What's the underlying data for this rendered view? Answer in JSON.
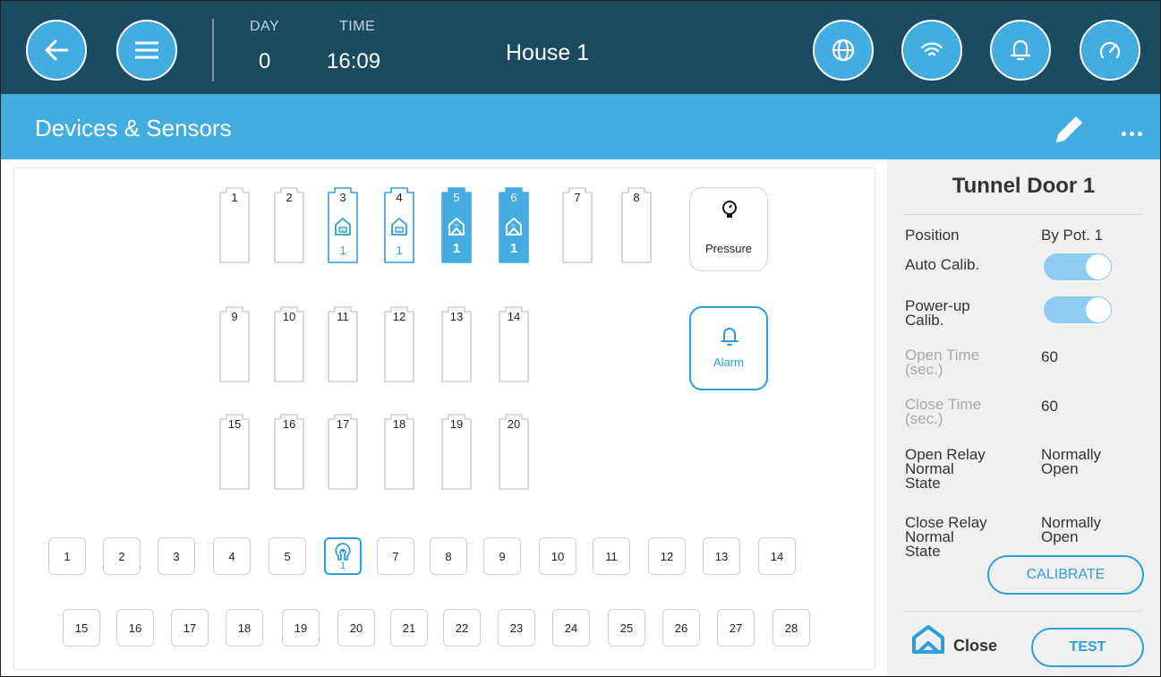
{
  "header": {
    "day_label": "DAY",
    "day_value": "0",
    "time_label": "TIME",
    "time_value": "16:09",
    "house_title": "House 1",
    "icons": [
      "back-arrow-icon",
      "menu-icon",
      "globe-icon",
      "wifi-icon",
      "bell-icon",
      "gauge-icon"
    ]
  },
  "titlebar": {
    "title": "Devices & Sensors",
    "icons": [
      "pencil-icon",
      "more-icon"
    ]
  },
  "relays": [
    {
      "label": "1"
    },
    {
      "label": "2"
    },
    {
      "label": "3",
      "state": "assigned",
      "sub": "1",
      "icon": "door-open-icon"
    },
    {
      "label": "4",
      "state": "assigned",
      "sub": "1",
      "icon": "door-close-icon"
    },
    {
      "label": "5",
      "state": "active",
      "sub": "1",
      "icon": "tunnel-open-icon"
    },
    {
      "label": "6",
      "state": "active",
      "sub": "1",
      "icon": "tunnel-close-icon"
    },
    {
      "label": "7"
    },
    {
      "label": "8"
    },
    {
      "label": "9"
    },
    {
      "label": "10"
    },
    {
      "label": "11"
    },
    {
      "label": "12"
    },
    {
      "label": "13"
    },
    {
      "label": "14"
    },
    {
      "label": "15"
    },
    {
      "label": "16"
    },
    {
      "label": "17"
    },
    {
      "label": "18"
    },
    {
      "label": "19"
    },
    {
      "label": "20"
    }
  ],
  "cards": {
    "pressure_label": "Pressure",
    "alarm_label": "Alarm"
  },
  "inputs_row1": [
    "1",
    "2",
    "3",
    "4",
    "5",
    "6",
    "7",
    "8",
    "9",
    "10",
    "11",
    "12",
    "13",
    "14"
  ],
  "inputs_row2": [
    "15",
    "16",
    "17",
    "18",
    "19",
    "20",
    "21",
    "22",
    "23",
    "24",
    "25",
    "26",
    "27",
    "28"
  ],
  "selected_input": {
    "index": "6",
    "sub": "1",
    "icon": "potentiometer-icon"
  },
  "panel": {
    "title": "Tunnel Door 1",
    "position_label": "Position",
    "position_value": "By Pot. 1",
    "auto_calib_label": "Auto Calib.",
    "auto_calib_on": true,
    "powerup_label_1": "Power-up",
    "powerup_label_2": "Calib.",
    "powerup_on": true,
    "open_time_label_1": "Open Time",
    "open_time_label_2": "(sec.)",
    "open_time_value": "60",
    "close_time_label_1": "Close Time",
    "close_time_label_2": "(sec.)",
    "close_time_value": "60",
    "open_relay_label_1": "Open Relay",
    "open_relay_label_2": "Normal",
    "open_relay_label_3": "State",
    "open_relay_value_1": "Normally",
    "open_relay_value_2": "Open",
    "close_relay_label_1": "Close Relay",
    "close_relay_label_2": "Normal",
    "close_relay_label_3": "State",
    "close_relay_value_1": "Normally",
    "close_relay_value_2": "Open",
    "calibrate_label": "CALIBRATE",
    "status_label": "Close",
    "test_label": "TEST"
  },
  "colors": {
    "header_bg": "#1b4a63",
    "accent": "#43ace0",
    "active_blue": "#2b9fdc",
    "panel_bg": "#f0f0f0"
  }
}
